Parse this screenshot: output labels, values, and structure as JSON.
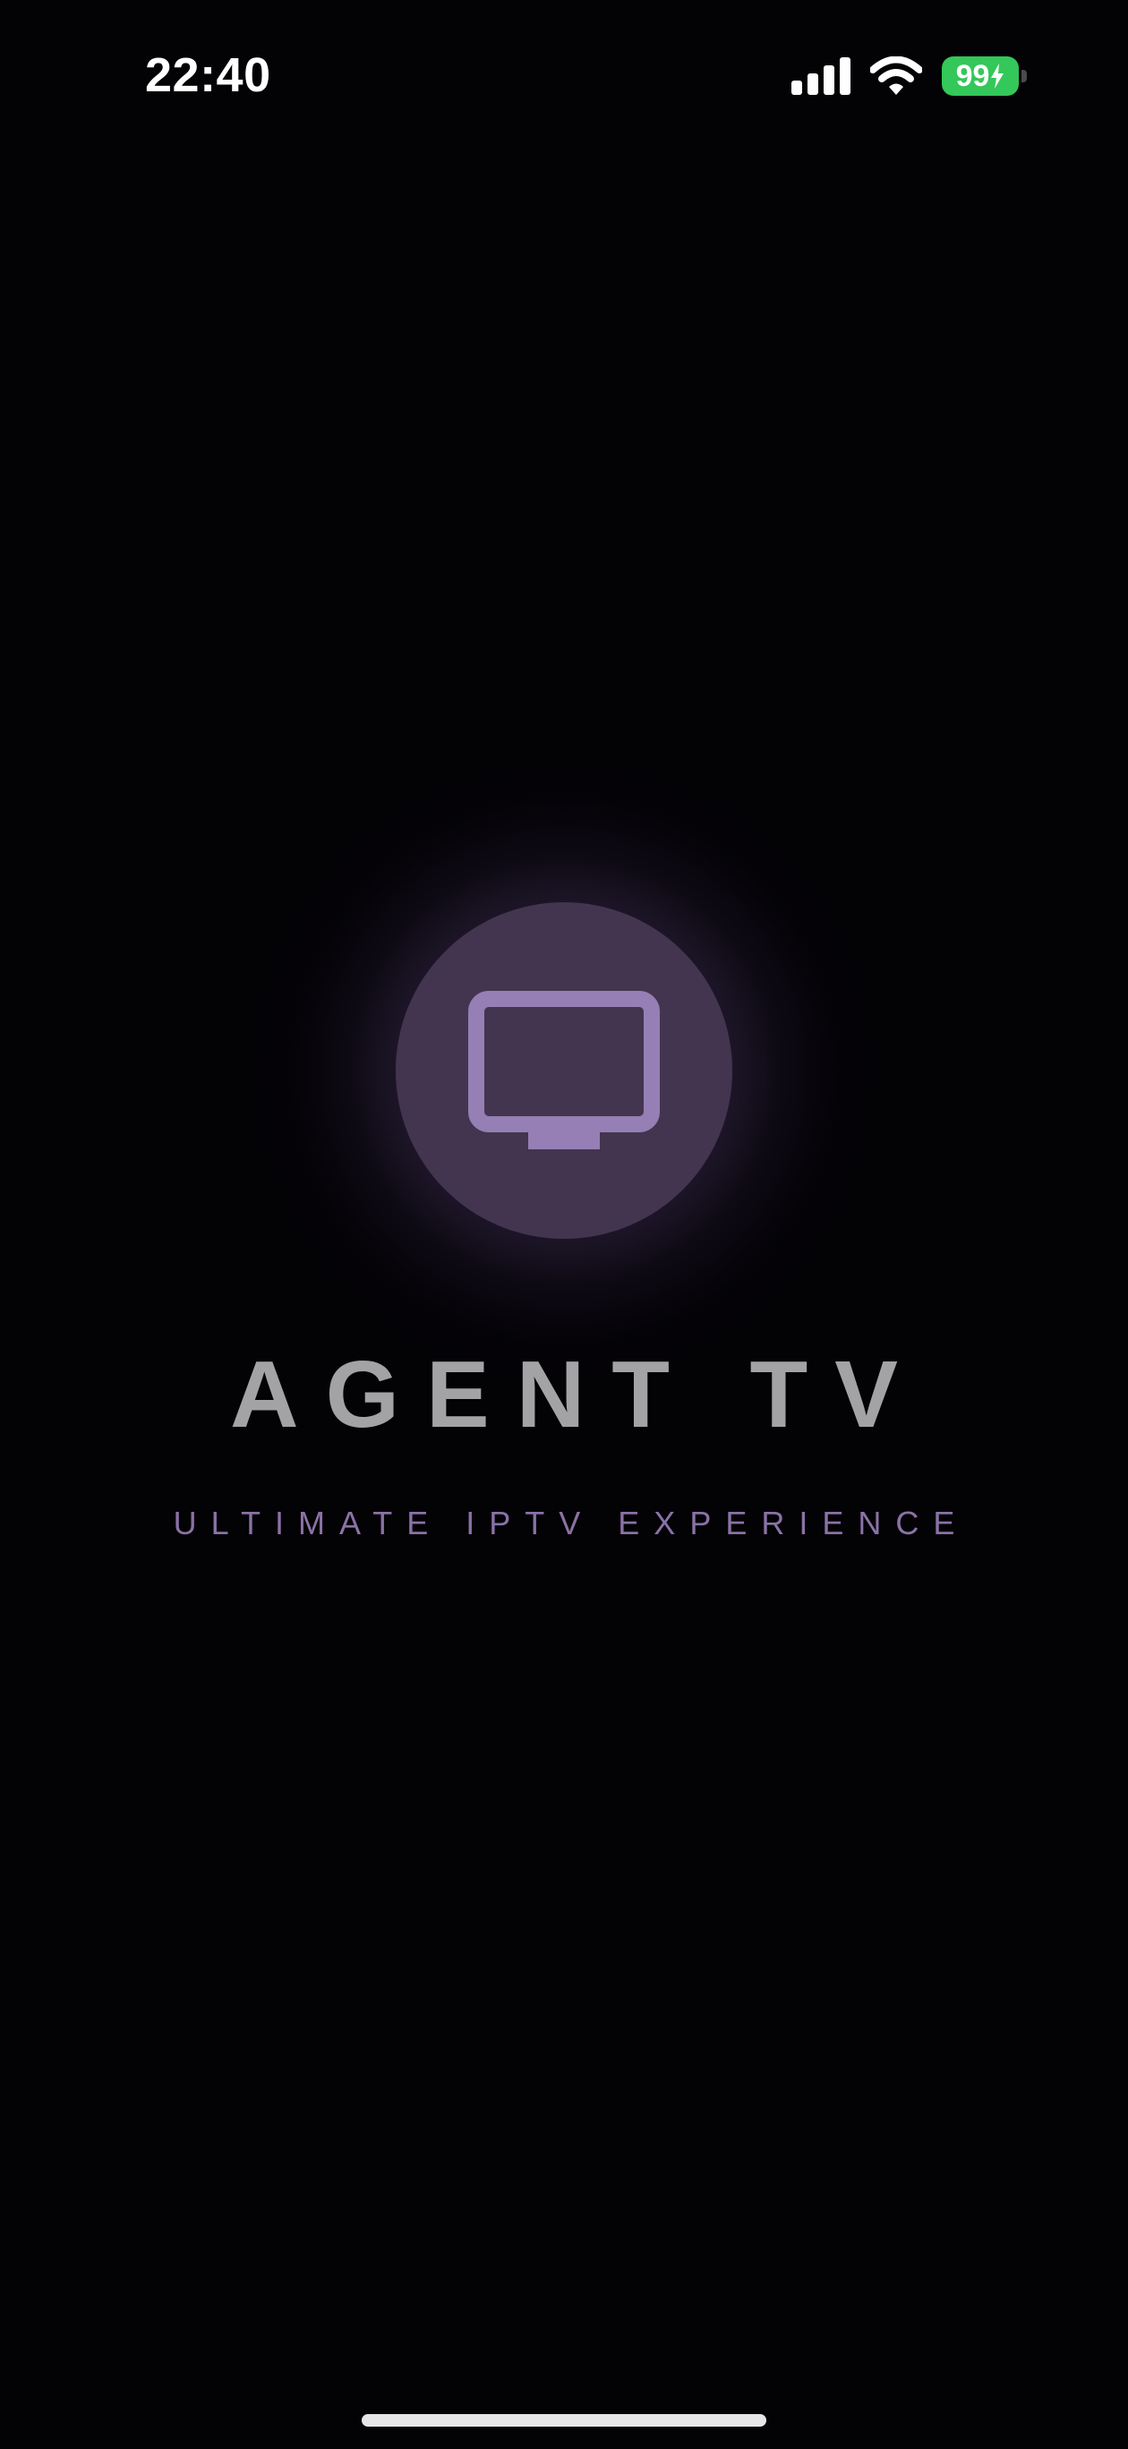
{
  "status_bar": {
    "time": "22:40",
    "battery_level": "99",
    "battery_charging": true,
    "signal_bars": 4,
    "icons": [
      "cellular-signal-icon",
      "wifi-icon",
      "battery-icon",
      "charging-bolt-icon"
    ]
  },
  "splash": {
    "logo_icon": "tv-icon",
    "title": "AGENT TV",
    "subtitle": "ULTIMATE IPTV EXPERIENCE"
  },
  "colors": {
    "background": "#030205",
    "accent": "#967fb4",
    "logo_circle": "#433550",
    "title": "#a3a3a6",
    "subtitle": "#8a72a6",
    "battery": "#34c759"
  }
}
